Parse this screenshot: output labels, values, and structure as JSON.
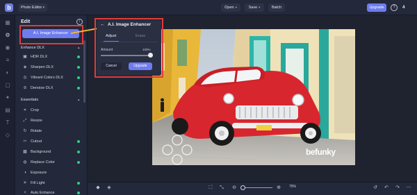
{
  "topbar": {
    "app_select": "Photo Editor",
    "open_label": "Open",
    "save_label": "Save",
    "batch_label": "Batch",
    "upgrade_label": "Upgrade",
    "help_symbol": "?",
    "count": "4"
  },
  "rail": {
    "icons": [
      "grid-icon",
      "sliders-icon",
      "eye-icon",
      "layers-icon",
      "palette-icon",
      "frame-icon",
      "star-icon",
      "grid2-icon",
      "text-icon",
      "shapes-icon"
    ]
  },
  "panel": {
    "title": "Edit",
    "info_symbol": "i",
    "enhancer_button": "A.I. Image Enhancer",
    "enhance_section": "Enhance DLX",
    "enhance_items": [
      {
        "label": "HDR DLX",
        "icon": "hdr-icon"
      },
      {
        "label": "Sharpen DLX",
        "icon": "sharpen-icon"
      },
      {
        "label": "Vibrant Colors DLX",
        "icon": "vibrant-icon"
      },
      {
        "label": "Denoise DLX",
        "icon": "denoise-icon"
      }
    ],
    "essentials_section": "Essentials",
    "essentials_items": [
      {
        "label": "Crop",
        "icon": "crop-icon",
        "dot": false
      },
      {
        "label": "Resize",
        "icon": "resize-icon",
        "dot": false
      },
      {
        "label": "Rotate",
        "icon": "rotate-icon",
        "dot": false
      },
      {
        "label": "Cutout",
        "icon": "cutout-icon",
        "dot": true
      },
      {
        "label": "Background",
        "icon": "background-icon",
        "dot": true
      },
      {
        "label": "Replace Color",
        "icon": "replace-color-icon",
        "dot": true
      },
      {
        "label": "Exposure",
        "icon": "exposure-icon",
        "dot": false
      },
      {
        "label": "Fill Light",
        "icon": "fill-light-icon",
        "dot": true
      },
      {
        "label": "Auto Enhance",
        "icon": "auto-enhance-icon",
        "dot": true
      }
    ],
    "dot_color": "#2ecf8a"
  },
  "popup": {
    "back_symbol": "←",
    "title": "A.I. Image Enhancer",
    "tab_adjust": "Adjust",
    "tab_erase": "Erase",
    "amount_label": "Amount",
    "amount_value": "100%",
    "amount_level": 1.0,
    "cancel_label": "Cancel",
    "upgrade_label": "Upgrade"
  },
  "photo": {
    "watermark": "befunky"
  },
  "bottombar": {
    "zoom_value": "75%",
    "zoom_level": 0.0
  },
  "colors": {
    "accent": "#6e7cf0",
    "highlight": "#e23b3b",
    "arrow": "#f2b62a",
    "car": "#d8262f"
  }
}
